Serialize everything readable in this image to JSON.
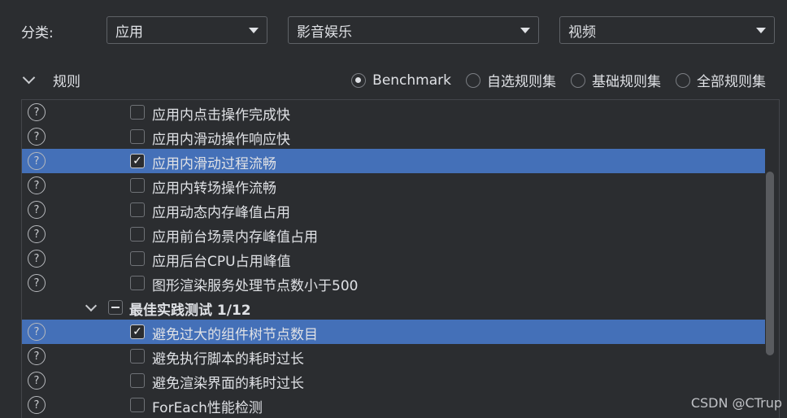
{
  "filters": {
    "category_label": "分类:",
    "category_value": "应用",
    "subcategory_value": "影音娱乐",
    "type_value": "视频"
  },
  "rules_section": {
    "title": "规则",
    "radios": [
      {
        "label": "Benchmark",
        "selected": true
      },
      {
        "label": "自选规则集",
        "selected": false
      },
      {
        "label": "基础规则集",
        "selected": false
      },
      {
        "label": "全部规则集",
        "selected": false
      }
    ]
  },
  "rules": [
    {
      "label": "应用内点击操作完成快",
      "checked": false,
      "selected": false
    },
    {
      "label": "应用内滑动操作响应快",
      "checked": false,
      "selected": false
    },
    {
      "label": "应用内滑动过程流畅",
      "checked": true,
      "selected": true
    },
    {
      "label": "应用内转场操作流畅",
      "checked": false,
      "selected": false
    },
    {
      "label": "应用动态内存峰值占用",
      "checked": false,
      "selected": false
    },
    {
      "label": "应用前台场景内存峰值占用",
      "checked": false,
      "selected": false
    },
    {
      "label": "应用后台CPU占用峰值",
      "checked": false,
      "selected": false
    },
    {
      "label": "图形渲染服务处理节点数小于500",
      "checked": false,
      "selected": false
    }
  ],
  "group": {
    "label": "最佳实践测试 1/12",
    "state": "partial"
  },
  "group_rules": [
    {
      "label": "避免过大的组件树节点数目",
      "checked": true,
      "selected": true
    },
    {
      "label": "避免执行脚本的耗时过长",
      "checked": false,
      "selected": false
    },
    {
      "label": "避免渲染界面的耗时过长",
      "checked": false,
      "selected": false
    },
    {
      "label": "ForEach性能检测",
      "checked": false,
      "selected": false
    }
  ],
  "help_glyph": "?",
  "check_glyph": "✓",
  "watermark": "CSDN @CTrup"
}
